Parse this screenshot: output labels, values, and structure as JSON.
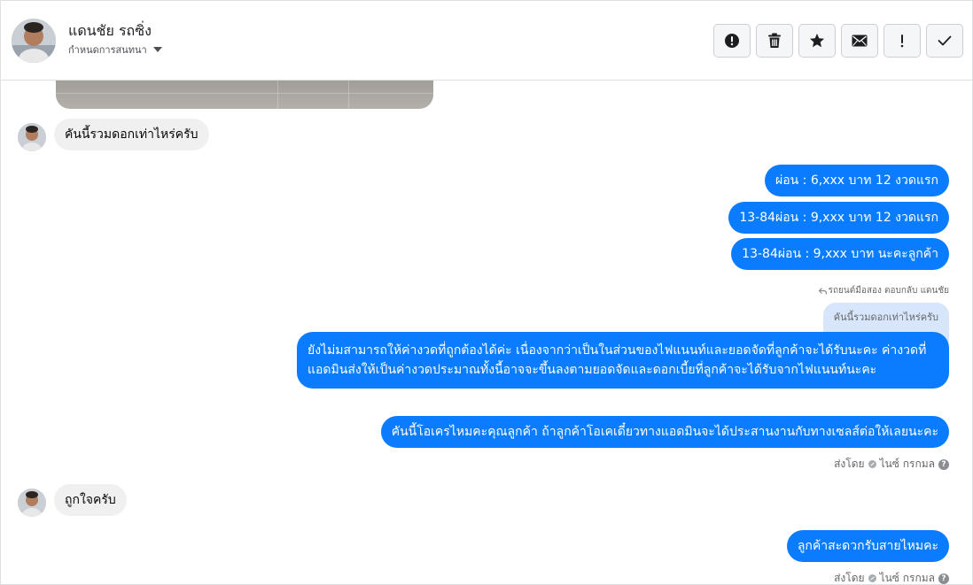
{
  "header": {
    "contact_name": "แดนชัย รถซิ่ง",
    "conversation_setting": "กำหนดการสนทนา",
    "actions": [
      {
        "name": "report-button",
        "icon": "alert-circle-icon"
      },
      {
        "name": "delete-button",
        "icon": "trash-icon"
      },
      {
        "name": "star-button",
        "icon": "star-icon"
      },
      {
        "name": "mark-unread-button",
        "icon": "envelope-icon"
      },
      {
        "name": "follow-up-button",
        "icon": "exclamation-icon"
      },
      {
        "name": "mark-done-button",
        "icon": "checkmark-icon"
      }
    ]
  },
  "messages": {
    "m1_incoming": "คันนี้รวมดอกเท่าไหร่ครับ",
    "m2_outgoing": "ผ่อน : 6,xxx บาท 12 งวดแรก",
    "m3_outgoing": "13-84ผ่อน : 9,xxx บาท 12 งวดแรก",
    "m4_outgoing": "13-84ผ่อน : 9,xxx บาท  นะคะลูกค้า",
    "reply_meta": "รถยนต์มือสอง ตอบกลับ แดนชัย",
    "quoted_text": "คันนี้รวมดอกเท่าไหร่ครับ",
    "m5_outgoing": "ยังไม่มสามารถให้ค่างวดที่ถูกต้องได้ค่ะ เนื่องจากว่าเป็นในส่วนของไฟแนนท์และยอดจัดที่ลูกค้าจะได้รับนะคะ ค่างวดที่แอดมินส่งให้เป็นค่างวดประมาณทั้งนี้อาจจะขึ้นลงตามยอดจัดและดอกเบี้ยที่ลูกค้าจะได้รับจากไฟแนนท์นะคะ",
    "m6_outgoing": "คันนี้โอเครไหมคะคุณลูกค้า ถ้าลูกค้าโอเคเดี๋ยวทางแอดมินจะได้ประสานงานกับทางเซลส์ต่อให้เลยนะคะ",
    "sent_by_1": "ส่งโดย",
    "sender_1": "ไนซ์ กรกมล",
    "m7_incoming": "ถูกใจครับ",
    "m8_outgoing": "ลูกค้าสะดวกรับสายไหมคะ",
    "sent_by_2": "ส่งโดย",
    "sender_2": "ไนซ์ กรกมล"
  },
  "colors": {
    "outgoing_bubble": "#0a7cff",
    "incoming_bubble": "#f0f0f0",
    "quote_bubble": "#d8e6fb"
  }
}
